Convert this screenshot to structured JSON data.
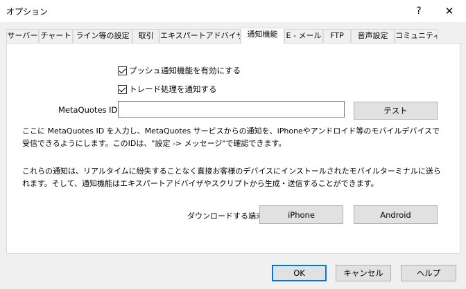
{
  "window": {
    "title": "オプション",
    "help_glyph": "?",
    "close_glyph": "✕"
  },
  "tabs": [
    {
      "label": "サーバー"
    },
    {
      "label": "チャート"
    },
    {
      "label": "ライン等の設定"
    },
    {
      "label": "取引"
    },
    {
      "label": "エキスパートアドバイザ"
    },
    {
      "label": "通知機能",
      "active": true
    },
    {
      "label": "E - メール"
    },
    {
      "label": "FTP"
    },
    {
      "label": "音声設定"
    },
    {
      "label": "コミュニティ"
    }
  ],
  "notifications": {
    "enable_push_label": "プッシュ通知機能を有効にする",
    "enable_push_checked": true,
    "notify_trade_label": "トレード処理を通知する",
    "notify_trade_checked": true,
    "metaquotes_id_label": "MetaQuotes ID",
    "metaquotes_id_value": "",
    "test_button": "テスト",
    "info_text_1": "ここに MetaQuotes ID を入力し、MetaQuotes サービスからの通知を、iPhoneやアンドロイド等のモバイルデバイスで受信できるようにします。このIDは、\"設定 -> メッセージ\"で確認できます。",
    "info_text_2": "これらの通知は、リアルタイムに紛失することなく直接お客様のデバイスにインストールされたモバイルターミナルに送られます。そして、通知機能はエキスパートアドバイザやスクリプトから生成・送信することができます。",
    "download_label": "ダウンロードする端末:",
    "iphone_button": "iPhone",
    "android_button": "Android"
  },
  "footer": {
    "ok_button": "OK",
    "cancel_button": "キャンセル",
    "help_button": "ヘルプ"
  },
  "colors": {
    "focus_border": "#0078d7",
    "button_bg": "#e1e1e1",
    "dialog_bg": "#f0f0f0"
  }
}
